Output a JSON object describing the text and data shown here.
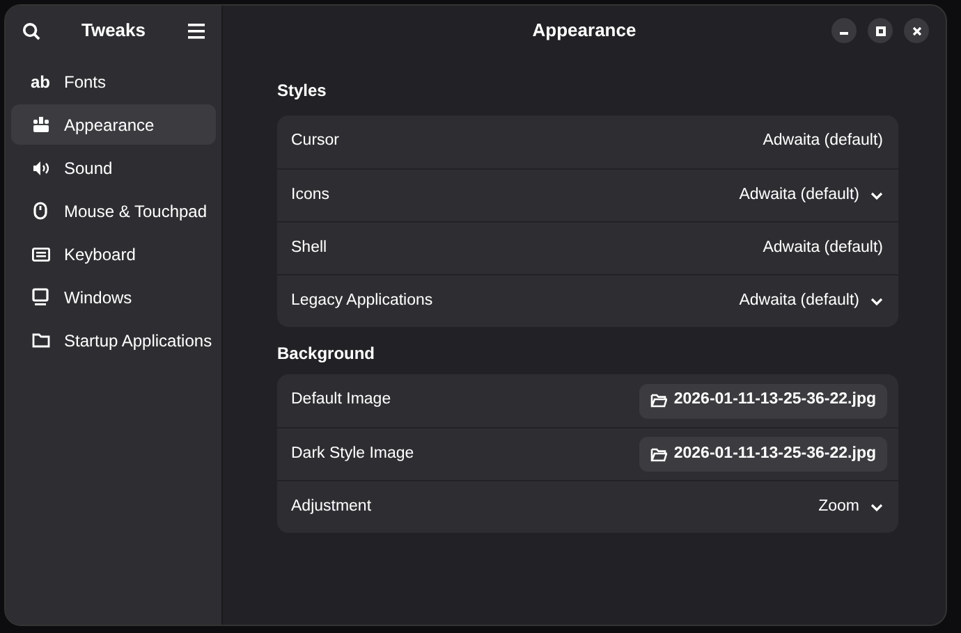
{
  "sidebar": {
    "title": "Tweaks",
    "items": [
      {
        "label": "Fonts",
        "glyph": "ab",
        "selected": false
      },
      {
        "label": "Appearance",
        "selected": true
      },
      {
        "label": "Sound",
        "selected": false
      },
      {
        "label": "Mouse & Touchpad",
        "selected": false
      },
      {
        "label": "Keyboard",
        "selected": false
      },
      {
        "label": "Windows",
        "selected": false
      },
      {
        "label": "Startup Applications",
        "selected": false
      }
    ]
  },
  "window": {
    "title": "Appearance"
  },
  "sections": [
    {
      "heading": "Styles",
      "rows": [
        {
          "label": "Cursor",
          "kind": "text",
          "value": "Adwaita (default)"
        },
        {
          "label": "Icons",
          "kind": "dropdown",
          "value": "Adwaita (default)"
        },
        {
          "label": "Shell",
          "kind": "text",
          "value": "Adwaita (default)"
        },
        {
          "label": "Legacy Applications",
          "kind": "dropdown",
          "value": "Adwaita (default)"
        }
      ]
    },
    {
      "heading": "Background",
      "rows": [
        {
          "label": "Default Image",
          "kind": "file",
          "value": "2026-01-11-13-25-36-22.jpg"
        },
        {
          "label": "Dark Style Image",
          "kind": "file",
          "value": "2026-01-11-13-25-36-22.jpg"
        },
        {
          "label": "Adjustment",
          "kind": "dropdown",
          "value": "Zoom"
        }
      ]
    }
  ]
}
